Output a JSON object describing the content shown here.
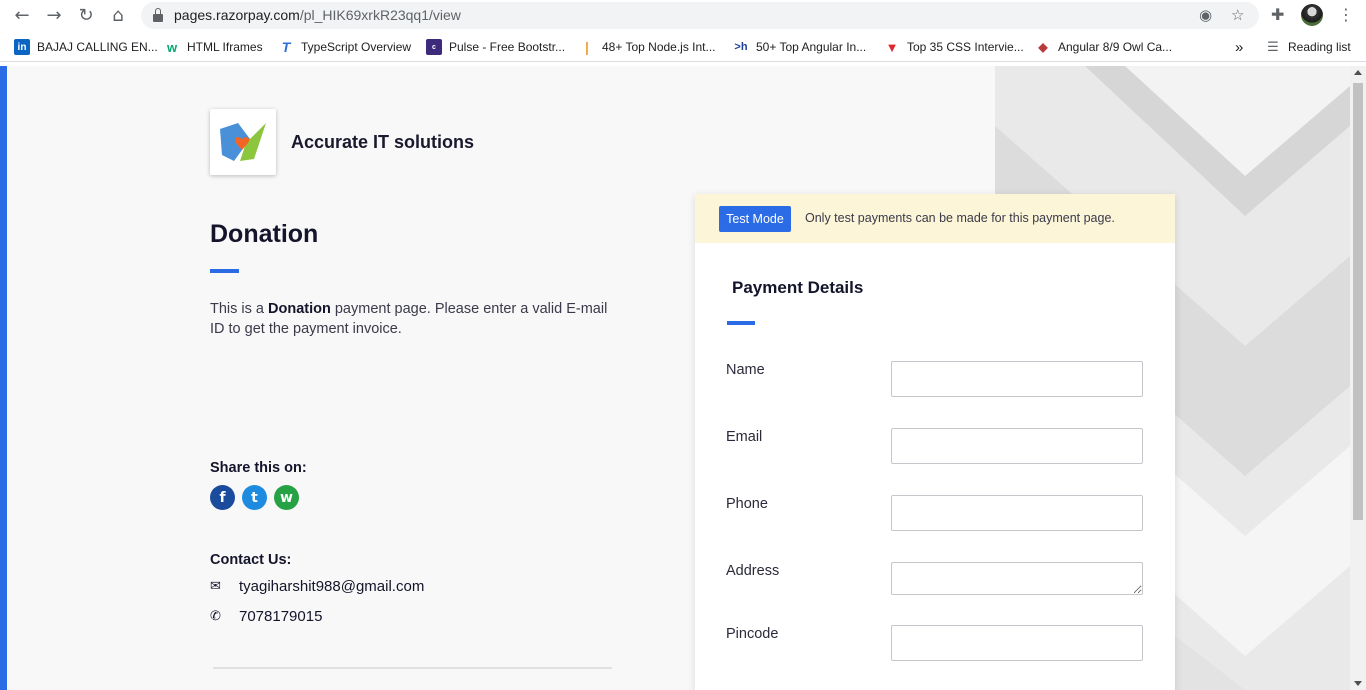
{
  "browser": {
    "url_host": "pages.razorpay.com",
    "url_path": "/pl_HIK69xrkR23qq1/view",
    "bookmarks": [
      {
        "label": "BAJAJ CALLING EN...",
        "icon": "linkedin-icon",
        "color": "#0a66c2",
        "glyph": "in"
      },
      {
        "label": "HTML Iframes",
        "icon": "w3schools-icon",
        "color": "#04aa6d",
        "glyph": "w"
      },
      {
        "label": "TypeScript Overview",
        "icon": "typescript-icon",
        "color": "#2e6fd8",
        "glyph": "T"
      },
      {
        "label": "Pulse - Free Bootstr...",
        "icon": "colorlib-icon",
        "color": "#3d2a7a",
        "glyph": "c"
      },
      {
        "label": "48+ Top Node.js Int...",
        "icon": "bars-icon",
        "color": "#f2a23a",
        "glyph": "|"
      },
      {
        "label": "50+ Top Angular In...",
        "icon": "hackr-icon",
        "color": "#1c3f94",
        "glyph": ">h"
      },
      {
        "label": "Top 35 CSS Intervie...",
        "icon": "triangle-icon",
        "color": "#e0262b",
        "glyph": "▼"
      },
      {
        "label": "Angular 8/9 Owl Ca...",
        "icon": "site-icon",
        "color": "#b83a3a",
        "glyph": "◆"
      }
    ],
    "overflow_label": "»",
    "reading_list_label": "Reading list"
  },
  "merchant": {
    "name": "Accurate IT solutions"
  },
  "page": {
    "title": "Donation",
    "desc_prefix": "This is a ",
    "desc_bold": "Donation",
    "desc_suffix": " payment page. Please enter a valid E-mail ID to get the payment invoice.",
    "share_label": "Share this on:",
    "contact_label": "Contact Us:",
    "contact_email": "tyagiharshit988@gmail.com",
    "contact_phone": "7078179015"
  },
  "card": {
    "test_badge": "Test Mode",
    "test_message": "Only test payments can be made for this payment page.",
    "title": "Payment Details",
    "fields": [
      {
        "label": "Name",
        "value": ""
      },
      {
        "label": "Email",
        "value": ""
      },
      {
        "label": "Phone",
        "value": ""
      },
      {
        "label": "Address",
        "value": ""
      },
      {
        "label": "Pincode",
        "value": ""
      }
    ]
  },
  "colors": {
    "accent": "#2b6be6",
    "banner_bg": "#fcf5d7",
    "facebook": "#1a4b9c",
    "twitter": "#1d8ce0",
    "whatsapp": "#25a244"
  },
  "icons": {
    "facebook": "f",
    "twitter": "t",
    "whatsapp": "w"
  }
}
